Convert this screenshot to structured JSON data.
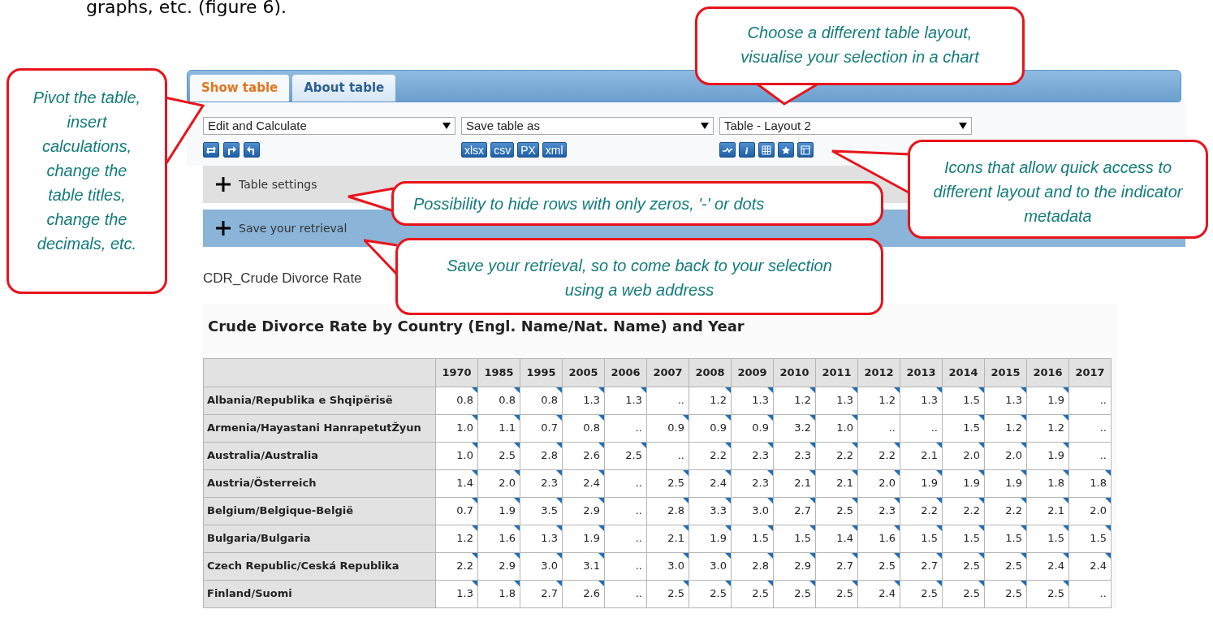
{
  "document_text": "graphs, etc. (figure 6).",
  "tabs": [
    {
      "label": "Show table",
      "selected": true
    },
    {
      "label": "About table",
      "selected": false
    }
  ],
  "toolbar": {
    "dropdowns": [
      {
        "value": "Edit and Calculate"
      },
      {
        "value": "Save table as"
      },
      {
        "value": "Table - Layout 2"
      }
    ],
    "export_buttons": [
      "xlsx",
      "csv",
      "PX",
      "xml"
    ]
  },
  "sections": [
    {
      "label": "Table settings",
      "kind": "plain"
    },
    {
      "label": "Save your retrieval",
      "kind": "highlight"
    }
  ],
  "indicator": "CDR_Crude Divorce Rate",
  "table": {
    "title": "Crude Divorce Rate by Country (Engl. Name/Nat. Name) and Year",
    "columns": [
      "1970",
      "1985",
      "1995",
      "2005",
      "2006",
      "2007",
      "2008",
      "2009",
      "2010",
      "2011",
      "2012",
      "2013",
      "2014",
      "2015",
      "2016",
      "2017"
    ],
    "rows": [
      {
        "label": "Albania/Republika e Shqipërisë",
        "cells": [
          "0.8",
          "0.8",
          "0.8",
          "1.3",
          "1.3",
          "..",
          "1.2",
          "1.3",
          "1.2",
          "1.3",
          "1.2",
          "1.3",
          "1.5",
          "1.3",
          "1.9",
          ".."
        ],
        "notes": [
          true,
          true,
          true,
          true,
          true,
          false,
          true,
          true,
          true,
          true,
          true,
          true,
          true,
          true,
          true,
          false
        ]
      },
      {
        "label": "Armenia/Hayastani HanrapetutŽyun",
        "cells": [
          "1.0",
          "1.1",
          "0.7",
          "0.8",
          "..",
          "0.9",
          "0.9",
          "0.9",
          "3.2",
          "1.0",
          "..",
          "..",
          "1.5",
          "1.2",
          "1.2",
          ".."
        ],
        "notes": [
          true,
          true,
          true,
          true,
          false,
          true,
          true,
          true,
          true,
          true,
          false,
          false,
          true,
          true,
          true,
          false
        ]
      },
      {
        "label": "Australia/Australia",
        "cells": [
          "1.0",
          "2.5",
          "2.8",
          "2.6",
          "2.5",
          "..",
          "2.2",
          "2.3",
          "2.3",
          "2.2",
          "2.2",
          "2.1",
          "2.0",
          "2.0",
          "1.9",
          ".."
        ],
        "notes": [
          true,
          true,
          true,
          true,
          true,
          false,
          true,
          true,
          true,
          true,
          true,
          true,
          true,
          true,
          true,
          false
        ]
      },
      {
        "label": "Austria/Österreich",
        "cells": [
          "1.4",
          "2.0",
          "2.3",
          "2.4",
          "..",
          "2.5",
          "2.4",
          "2.3",
          "2.1",
          "2.1",
          "2.0",
          "1.9",
          "1.9",
          "1.9",
          "1.8",
          "1.8"
        ],
        "notes": [
          true,
          true,
          true,
          true,
          false,
          true,
          true,
          true,
          true,
          true,
          true,
          true,
          true,
          true,
          true,
          true
        ]
      },
      {
        "label": "Belgium/Belgique-België",
        "cells": [
          "0.7",
          "1.9",
          "3.5",
          "2.9",
          "..",
          "2.8",
          "3.3",
          "3.0",
          "2.7",
          "2.5",
          "2.3",
          "2.2",
          "2.2",
          "2.2",
          "2.1",
          "2.0"
        ],
        "notes": [
          true,
          true,
          true,
          true,
          false,
          true,
          true,
          true,
          true,
          true,
          true,
          true,
          true,
          true,
          true,
          true
        ]
      },
      {
        "label": "Bulgaria/Bulgaria",
        "cells": [
          "1.2",
          "1.6",
          "1.3",
          "1.9",
          "..",
          "2.1",
          "1.9",
          "1.5",
          "1.5",
          "1.4",
          "1.6",
          "1.5",
          "1.5",
          "1.5",
          "1.5",
          "1.5"
        ],
        "notes": [
          true,
          true,
          true,
          true,
          false,
          true,
          true,
          true,
          true,
          true,
          true,
          true,
          true,
          true,
          true,
          true
        ]
      },
      {
        "label": "Czech Republic/Ceská Republika",
        "cells": [
          "2.2",
          "2.9",
          "3.0",
          "3.1",
          "..",
          "3.0",
          "3.0",
          "2.8",
          "2.9",
          "2.7",
          "2.5",
          "2.7",
          "2.5",
          "2.5",
          "2.4",
          "2.4"
        ],
        "notes": [
          true,
          true,
          true,
          true,
          false,
          true,
          true,
          true,
          true,
          true,
          true,
          true,
          true,
          true,
          true,
          true
        ]
      },
      {
        "label": "Finland/Suomi",
        "cells": [
          "1.3",
          "1.8",
          "2.7",
          "2.6",
          "..",
          "2.5",
          "2.5",
          "2.5",
          "2.5",
          "2.5",
          "2.4",
          "2.5",
          "2.5",
          "2.5",
          "2.5",
          ".."
        ],
        "notes": [
          true,
          true,
          true,
          true,
          false,
          true,
          true,
          true,
          true,
          true,
          true,
          true,
          true,
          true,
          true,
          false
        ]
      }
    ]
  },
  "callouts": [
    {
      "text": "Choose a different table layout, visualise your selection in a chart"
    },
    {
      "text": "Pivot the table, insert calculations, change the table titles, change the decimals, etc."
    },
    {
      "text": "Icons that allow quick access to different layout and to the indicator metadata"
    },
    {
      "text": "Possibility to hide rows with only zeros, '-' or dots"
    },
    {
      "text": "Save your retrieval, so to come back to your selection using a web address"
    }
  ]
}
